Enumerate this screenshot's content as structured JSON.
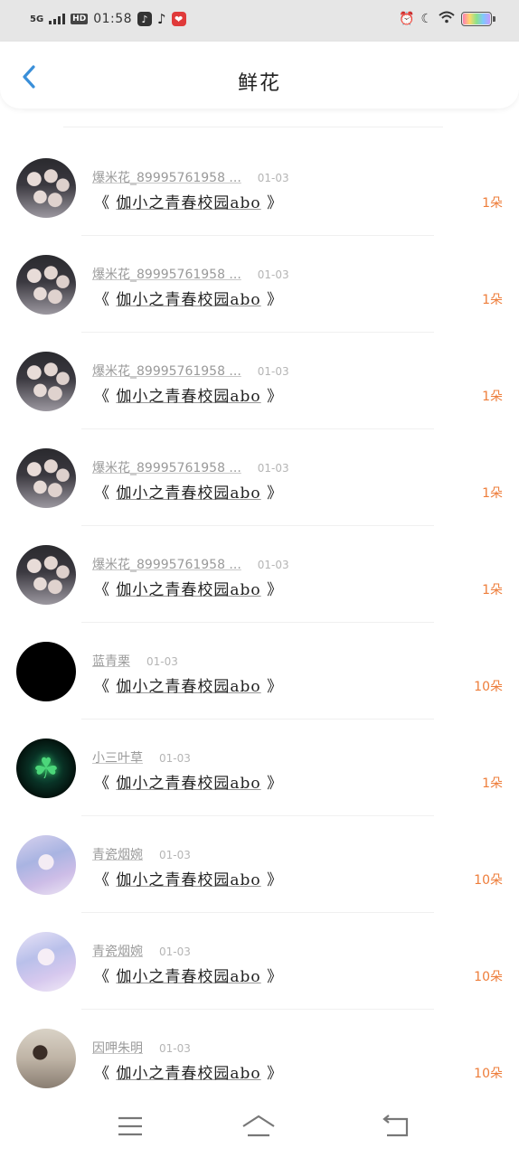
{
  "status_bar": {
    "network": "5G",
    "hd": "HD",
    "time": "01:58"
  },
  "header": {
    "title": "鲜花"
  },
  "gifts": [
    {
      "user": "爆米花_89995761958 ...",
      "date": "01-03",
      "book": "伽小之青春校园abo",
      "amount": "1朵",
      "avatar": "group-photo"
    },
    {
      "user": "爆米花_89995761958 ...",
      "date": "01-03",
      "book": "伽小之青春校园abo",
      "amount": "1朵",
      "avatar": "group-photo"
    },
    {
      "user": "爆米花_89995761958 ...",
      "date": "01-03",
      "book": "伽小之青春校园abo",
      "amount": "1朵",
      "avatar": "group-photo"
    },
    {
      "user": "爆米花_89995761958 ...",
      "date": "01-03",
      "book": "伽小之青春校园abo",
      "amount": "1朵",
      "avatar": "group-photo"
    },
    {
      "user": "爆米花_89995761958 ...",
      "date": "01-03",
      "book": "伽小之青春校园abo",
      "amount": "1朵",
      "avatar": "group-photo"
    },
    {
      "user": "蓝青栗",
      "date": "01-03",
      "book": "伽小之青春校园abo",
      "amount": "10朵",
      "avatar": "black-text"
    },
    {
      "user": "小三叶草",
      "date": "01-03",
      "book": "伽小之青春校园abo",
      "amount": "1朵",
      "avatar": "clover"
    },
    {
      "user": "青瓷烟婉",
      "date": "01-03",
      "book": "伽小之青春校园abo",
      "amount": "10朵",
      "avatar": "anime-girl"
    },
    {
      "user": "青瓷烟婉",
      "date": "01-03",
      "book": "伽小之青春校园abo",
      "amount": "10朵",
      "avatar": "anime-girl"
    },
    {
      "user": "因呷朱明",
      "date": "01-03",
      "book": "伽小之青春校园abo",
      "amount": "10朵",
      "avatar": "person-photo"
    }
  ],
  "colors": {
    "accent_blue": "#3a8fd9",
    "amount_orange": "#ee7d3a"
  },
  "icons": {
    "back": "chevron-left-icon",
    "nav_menu": "menu-icon",
    "nav_home": "home-icon",
    "nav_back": "return-icon"
  }
}
